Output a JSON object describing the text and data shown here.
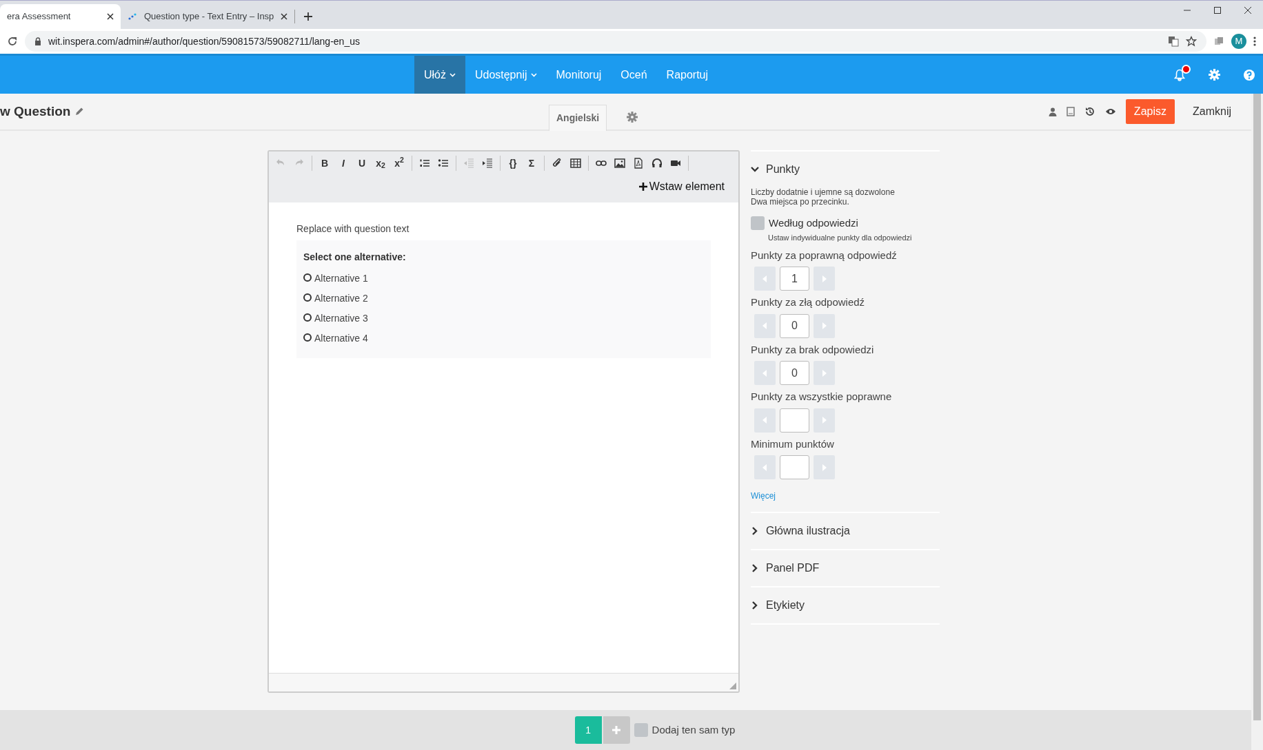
{
  "browser": {
    "tabs": [
      {
        "title": "era Assessment",
        "selected": true
      },
      {
        "title": "Question type - Text Entry – Insp",
        "selected": false
      }
    ],
    "address": "wit.inspera.com/admin#/author/question/59081573/59082711/lang-en_us",
    "profile": "M"
  },
  "nav": {
    "items": [
      {
        "label": "Ułóż",
        "selected": true,
        "dropdown": true
      },
      {
        "label": "Udostępnij",
        "selected": false,
        "dropdown": true
      },
      {
        "label": "Monitoruj",
        "selected": false,
        "dropdown": false
      },
      {
        "label": "Oceń",
        "selected": false,
        "dropdown": false
      },
      {
        "label": "Raportuj",
        "selected": false,
        "dropdown": false
      }
    ],
    "notification": true
  },
  "header": {
    "title": "w Question",
    "language": "Angielski",
    "save": "Zapisz",
    "close": "Zamknij"
  },
  "editor": {
    "toolbar": [
      {
        "kind": "undo",
        "disabled": true
      },
      {
        "kind": "redo",
        "disabled": true
      },
      {
        "kind": "sep"
      },
      {
        "kind": "text",
        "label": "B",
        "disabled": false
      },
      {
        "kind": "text",
        "label": "*I*",
        "disabled": false
      },
      {
        "kind": "text",
        "label": "U",
        "disabled": false
      },
      {
        "kind": "text",
        "label": "x$_{2}$",
        "disabled": false
      },
      {
        "kind": "text",
        "label": "x$^{2}$",
        "disabled": false
      },
      {
        "kind": "sep"
      },
      {
        "kind": "ol",
        "disabled": false
      },
      {
        "kind": "ul",
        "disabled": false
      },
      {
        "kind": "sep"
      },
      {
        "kind": "outdent",
        "disabled": true
      },
      {
        "kind": "indent",
        "disabled": false
      },
      {
        "kind": "sep"
      },
      {
        "kind": "text",
        "label": "{}",
        "disabled": false
      },
      {
        "kind": "text",
        "label": "Σ",
        "disabled": false
      },
      {
        "kind": "sep"
      },
      {
        "kind": "attach",
        "disabled": false
      },
      {
        "kind": "table",
        "disabled": false
      },
      {
        "kind": "sep"
      },
      {
        "kind": "link",
        "disabled": false
      },
      {
        "kind": "image",
        "disabled": false
      },
      {
        "kind": "pdf",
        "disabled": false
      },
      {
        "kind": "audio",
        "disabled": false
      },
      {
        "kind": "video",
        "disabled": false
      },
      {
        "kind": "sep"
      }
    ],
    "insert": "Wstaw element",
    "question_text": "Replace with question text",
    "prompt": "Select one alternative:",
    "alternatives": [
      {
        "label": "Alternative 1",
        "selected": false
      },
      {
        "label": "Alternative 2",
        "selected": false
      },
      {
        "label": "Alternative 3",
        "selected": false
      },
      {
        "label": "Alternative 4",
        "selected": false
      }
    ]
  },
  "panel": {
    "sections": [
      {
        "title": "Punkty",
        "expanded": true
      },
      {
        "title": "Główna ilustracja",
        "expanded": false
      },
      {
        "title": "Panel PDF",
        "expanded": false
      },
      {
        "title": "Etykiety",
        "expanded": false
      }
    ],
    "hints": [
      "Liczby dodatnie i ujemne są dozwolone",
      "Dwa miejsca po przecinku."
    ],
    "by_answer": {
      "label": "Według odpowiedzi",
      "hint": "Ustaw indywidualne punkty dla odpowiedzi",
      "checked": false
    },
    "fields": [
      {
        "label": "Punkty za poprawną odpowiedź",
        "value": "1"
      },
      {
        "label": "Punkty za złą odpowiedź",
        "value": "0"
      },
      {
        "label": "Punkty za brak odpowiedzi",
        "value": "0"
      },
      {
        "label": "Punkty za wszystkie poprawne"
      },
      {
        "label": "Minimum punktów"
      }
    ],
    "more": "Więcej"
  },
  "footer": {
    "pages": [
      {
        "label": "1",
        "selected": true
      }
    ],
    "same_type": {
      "label": "Dodaj ten sam typ",
      "checked": false
    }
  }
}
